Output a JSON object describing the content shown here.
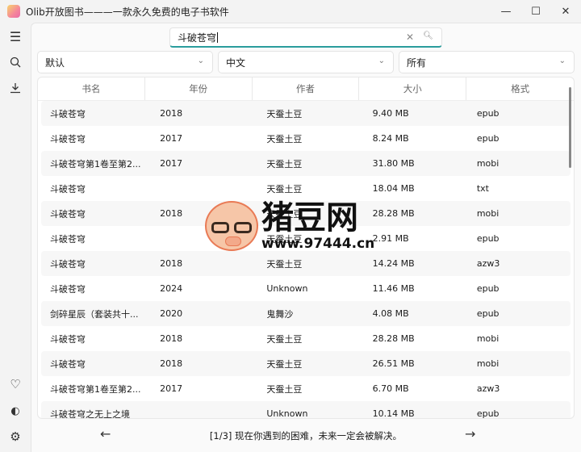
{
  "window": {
    "title": "Olib开放图书———一款永久免费的电子书软件"
  },
  "search": {
    "value": "斗破苍穹",
    "clear_icon": "close-icon",
    "search_icon": "search-icon"
  },
  "filters": [
    {
      "selected": "默认"
    },
    {
      "selected": "中文"
    },
    {
      "selected": "所有"
    }
  ],
  "table": {
    "columns": [
      "书名",
      "年份",
      "作者",
      "大小",
      "格式"
    ],
    "rows": [
      [
        "斗破苍穹",
        "2018",
        "天蚕土豆",
        "9.40 MB",
        "epub"
      ],
      [
        "斗破苍穹",
        "2017",
        "天蚕土豆",
        "8.24 MB",
        "epub"
      ],
      [
        "斗破苍穹第1卷至第2...",
        "2017",
        "天蚕土豆",
        "31.80 MB",
        "mobi"
      ],
      [
        "斗破苍穹",
        "",
        "天蚕土豆",
        "18.04 MB",
        "txt"
      ],
      [
        "斗破苍穹",
        "2018",
        "天蚕土豆",
        "28.28 MB",
        "mobi"
      ],
      [
        "斗破苍穹",
        "",
        "天蚕土豆",
        "2.91 MB",
        "epub"
      ],
      [
        "斗破苍穹",
        "2018",
        "天蚕土豆",
        "14.24 MB",
        "azw3"
      ],
      [
        "斗破苍穹",
        "2024",
        "Unknown",
        "11.46 MB",
        "epub"
      ],
      [
        "剑碎星辰（套装共十...",
        "2020",
        "鬼舞沙",
        "4.08 MB",
        "epub"
      ],
      [
        "斗破苍穹",
        "2018",
        "天蚕土豆",
        "28.28 MB",
        "mobi"
      ],
      [
        "斗破苍穹",
        "2018",
        "天蚕土豆",
        "26.51 MB",
        "mobi"
      ],
      [
        "斗破苍穹第1卷至第2...",
        "2017",
        "天蚕土豆",
        "6.70 MB",
        "azw3"
      ],
      [
        "斗破苍穹之无上之境",
        "",
        "Unknown",
        "10.14 MB",
        "epub"
      ]
    ]
  },
  "pager": {
    "text": "[1/3] 现在你遇到的困难，未来一定会被解决。"
  },
  "watermark": {
    "name": "猪豆网",
    "url": "www.97444.cn"
  },
  "colors": {
    "accent": "#2a9d9d"
  }
}
